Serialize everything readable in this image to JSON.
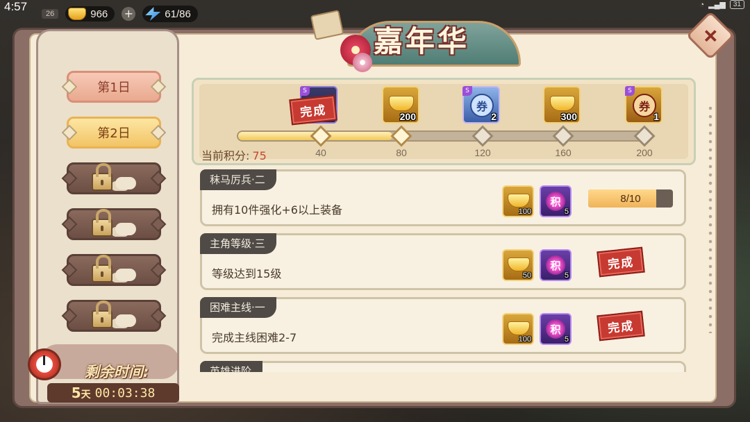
{
  "status": {
    "time": "4:57",
    "battery": "31"
  },
  "resources": {
    "level": "26",
    "gold": "966",
    "energy": "61/86",
    "gold_icon": "gold-ingot-icon",
    "energy_icon": "lightning-icon"
  },
  "title": "嘉年华",
  "days": [
    {
      "label": "第1日",
      "state": "unlocked"
    },
    {
      "label": "第2日",
      "state": "active"
    },
    {
      "label": "",
      "state": "locked"
    },
    {
      "label": "",
      "state": "locked"
    },
    {
      "label": "",
      "state": "locked"
    },
    {
      "label": "",
      "state": "locked"
    }
  ],
  "timer": {
    "label": "剩余时间:",
    "days": "5",
    "days_unit": "天",
    "clock": "00:03:38"
  },
  "progress": {
    "score_label": "当前积分:",
    "score": "75",
    "score_value": 75,
    "max": 200,
    "milestones": [
      "40",
      "80",
      "120",
      "160",
      "200"
    ],
    "rewards": [
      {
        "type": "dark-chest",
        "qty": "1",
        "claimed": true,
        "stamp": "完成"
      },
      {
        "type": "gold",
        "qty": "200"
      },
      {
        "type": "ticket-blue",
        "qty": "2",
        "glyph": "券"
      },
      {
        "type": "gold",
        "qty": "300"
      },
      {
        "type": "ticket-red",
        "qty": "1",
        "glyph": "券"
      }
    ]
  },
  "tasks": [
    {
      "tag": "秣马厉兵·二",
      "desc": "拥有10件强化+6以上装备",
      "gold_qty": "100",
      "score_glyph": "积",
      "score_qty": "5",
      "progress": "8/10",
      "progress_value": 0.8,
      "done": false
    },
    {
      "tag": "主角等级·三",
      "desc": "等级达到15级",
      "gold_qty": "50",
      "score_glyph": "积",
      "score_qty": "5",
      "stamp": "完成",
      "done": true
    },
    {
      "tag": "困难主线·一",
      "desc": "完成主线困难2-7",
      "gold_qty": "100",
      "score_glyph": "积",
      "score_qty": "5",
      "stamp": "完成",
      "done": true
    },
    {
      "tag": "英雄进阶",
      "desc": "",
      "done": false
    }
  ],
  "colors": {
    "accent_red": "#c73a31",
    "score_red": "#c4472f",
    "panel": "#f6ecd8"
  }
}
